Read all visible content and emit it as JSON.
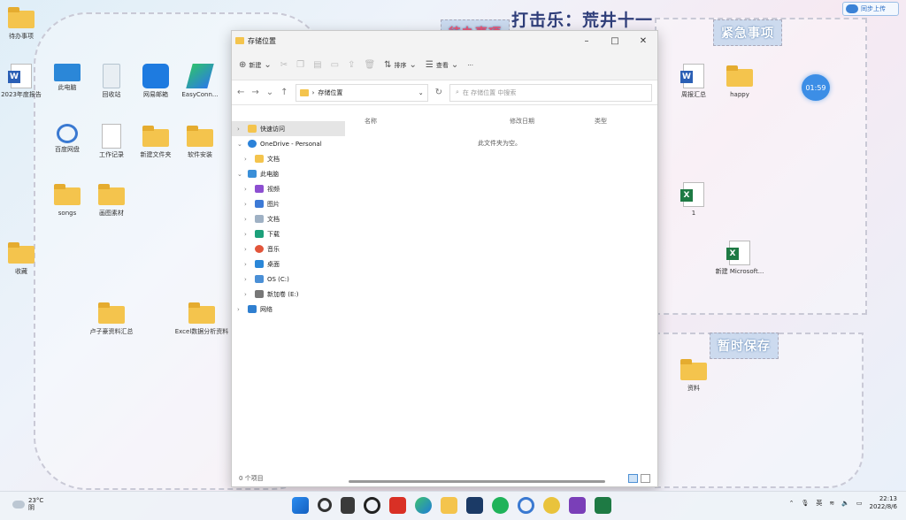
{
  "colors": {
    "accent": "#3c8ee6",
    "folder": "#f4c44d",
    "heading": "#2f3e7a"
  },
  "heading": "打击乐：荒井十一",
  "cloud_button": "同步上传",
  "clock_bubble": "01:59",
  "zone_tags": {
    "urgent": "紧急事项",
    "pending": "待办事项",
    "temp": "暂时保存"
  },
  "desktop_icons": [
    {
      "label": "待办事项",
      "kind": "folder"
    },
    {
      "label": "2023年度报告",
      "kind": "word"
    },
    {
      "label": "此电脑",
      "kind": "monitor"
    },
    {
      "label": "回收站",
      "kind": "recycle"
    },
    {
      "label": "网易邮箱",
      "kind": "blueapp"
    },
    {
      "label": "EasyConn...",
      "kind": "greenapp"
    },
    {
      "label": "百度网盘",
      "kind": "cloudapp"
    },
    {
      "label": "工作记录",
      "kind": "doc"
    },
    {
      "label": "新建文件夹",
      "kind": "folder"
    },
    {
      "label": "软件安装",
      "kind": "folder"
    },
    {
      "label": "songs",
      "kind": "folder"
    },
    {
      "label": "画图素材",
      "kind": "folder"
    },
    {
      "label": "收藏",
      "kind": "folder"
    },
    {
      "label": "卢子豪资料汇总",
      "kind": "folder"
    },
    {
      "label": "Excel数据分析资料",
      "kind": "folder"
    },
    {
      "label": "周报汇总",
      "kind": "word"
    },
    {
      "label": "happy",
      "kind": "folder"
    },
    {
      "label": "1",
      "kind": "excel"
    },
    {
      "label": "新建 Microsoft...",
      "kind": "excel"
    },
    {
      "label": "资料",
      "kind": "folder"
    }
  ],
  "explorer": {
    "title": "存储位置",
    "toolbar": {
      "new": "新建",
      "sort": "排序",
      "view": "查看",
      "more": "···"
    },
    "address": "存储位置",
    "search_placeholder": "在 存储位置 中搜索",
    "sidebar": [
      {
        "label": "快速访问",
        "level": 0,
        "icon": "star-icon"
      },
      {
        "label": "OneDrive - Personal",
        "level": 0,
        "icon": "cloud-icon"
      },
      {
        "label": "文档",
        "level": 1,
        "icon": "folder-icon"
      },
      {
        "label": "此电脑",
        "level": 0,
        "icon": "pc-icon"
      },
      {
        "label": "视频",
        "level": 1,
        "icon": "video-icon"
      },
      {
        "label": "图片",
        "level": 1,
        "icon": "picture-icon"
      },
      {
        "label": "文档",
        "level": 1,
        "icon": "document-icon"
      },
      {
        "label": "下载",
        "level": 1,
        "icon": "download-icon"
      },
      {
        "label": "音乐",
        "level": 1,
        "icon": "music-icon"
      },
      {
        "label": "桌面",
        "level": 1,
        "icon": "desktop-icon"
      },
      {
        "label": "OS (C:)",
        "level": 1,
        "icon": "drive-icon"
      },
      {
        "label": "新加卷 (E:)",
        "level": 1,
        "icon": "drive-icon"
      },
      {
        "label": "网络",
        "level": 0,
        "icon": "network-icon"
      }
    ],
    "columns": [
      "名称",
      "修改日期",
      "类型"
    ],
    "empty_text": "此文件夹为空。",
    "status": "0 个项目"
  },
  "taskbar": {
    "temp": "23°C",
    "weather": "阴",
    "ime": "英",
    "time": "22:13",
    "date": "2022/8/6"
  }
}
